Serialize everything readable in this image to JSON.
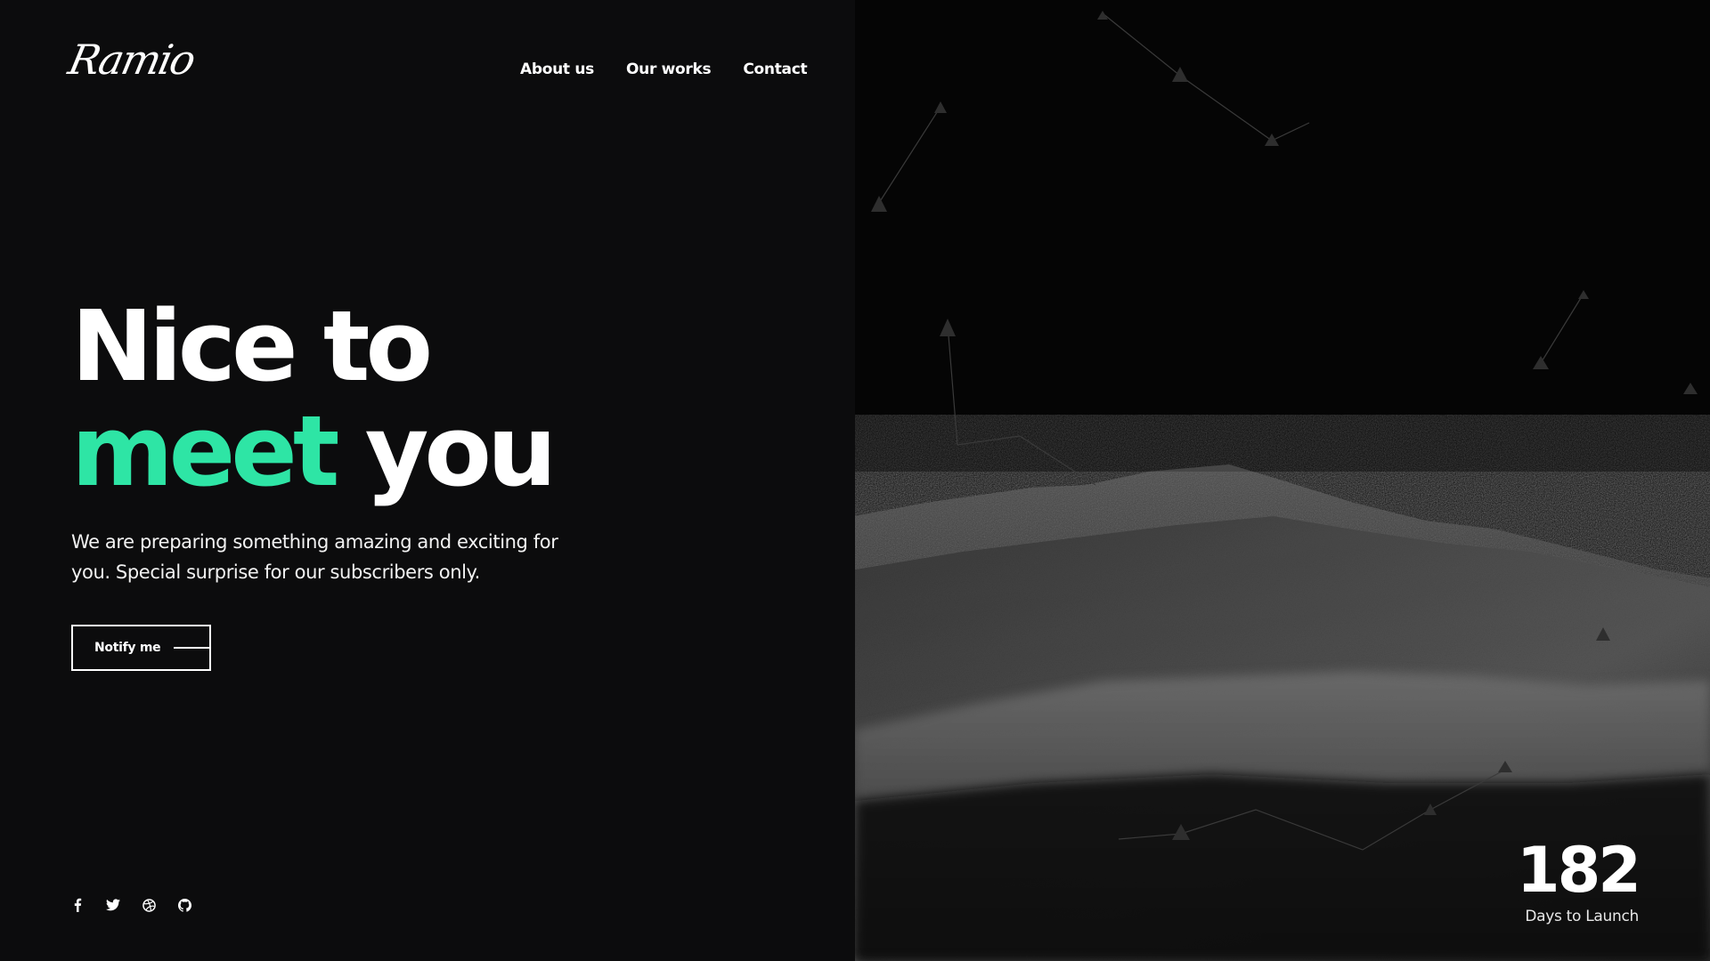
{
  "brand": {
    "logo_text": "Ramio"
  },
  "nav": {
    "items": [
      {
        "label": "About us"
      },
      {
        "label": "Our works"
      },
      {
        "label": "Contact"
      }
    ]
  },
  "hero": {
    "title_line1": "Nice to",
    "title_accent": "meet",
    "title_rest": " you",
    "description": "We are preparing something amazing and exciting for you. Special surprise for our subscribers only.",
    "button_label": "Notify me"
  },
  "socials": [
    {
      "icon": "facebook-icon"
    },
    {
      "icon": "twitter-icon"
    },
    {
      "icon": "dribbble-icon"
    },
    {
      "icon": "github-icon"
    }
  ],
  "countdown": {
    "value": "182",
    "label": "Days to Launch"
  },
  "colors": {
    "accent": "#2ee5a5",
    "background": "#0c0c0d",
    "text": "#ffffff"
  }
}
